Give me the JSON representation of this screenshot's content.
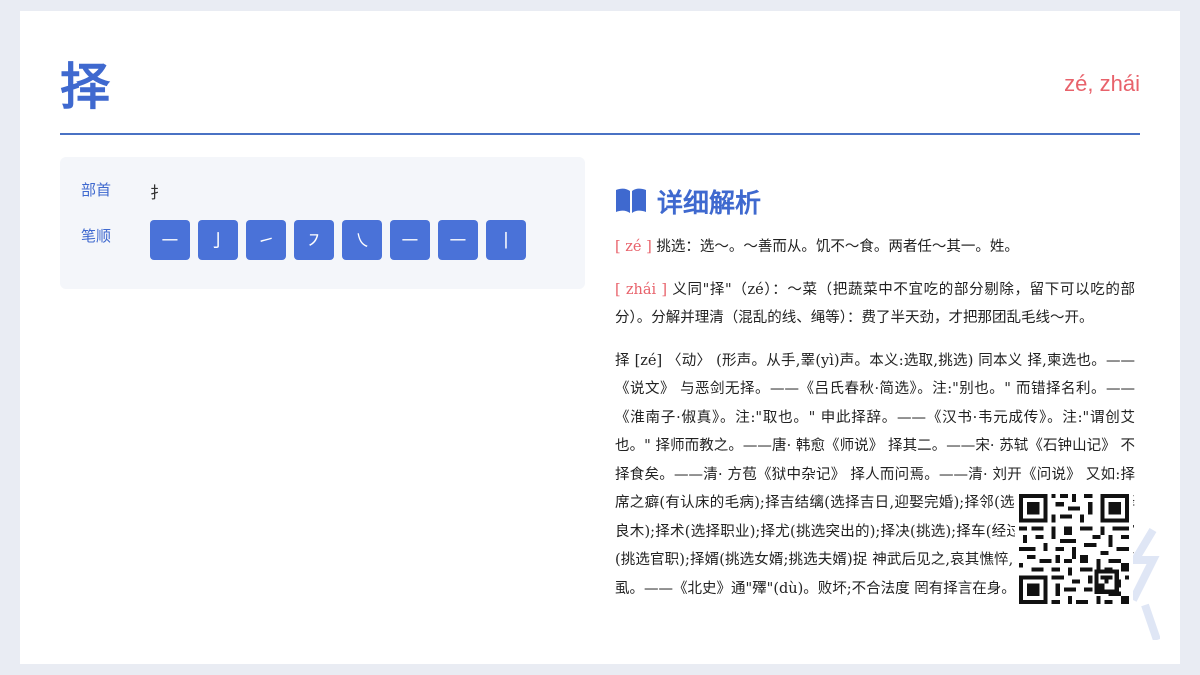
{
  "header": {
    "character": "择",
    "pinyin": "zé, zhái"
  },
  "info": {
    "radical_label": "部首",
    "radical": "扌",
    "strokes_label": "笔顺",
    "strokes": [
      "㇐",
      "亅",
      "㇀",
      "㇇",
      "㇏",
      "㇐",
      "㇐",
      "丨"
    ]
  },
  "detail": {
    "title": "详细解析",
    "entries": [
      {
        "pron": "[ zé ]",
        "text": " 挑选：选～。～善而从。饥不～食。两者任～其一。姓。"
      },
      {
        "pron": "[ zhái ]",
        "text": " 义同\"择\"（zé）：～菜（把蔬菜中不宜吃的部分剔除，留下可以吃的部分）。分解并理清（混乱的线、绳等）：费了半天劲，才把那团乱毛线～开。"
      },
      {
        "pron": "",
        "text": "择 [zé] 〈动〉 (形声。从手,睪(yì)声。本义:选取,挑选) 同本义 择,柬选也。——《说文》 与恶剑无择。——《吕氏春秋·简选》。注:\"别也。\" 而错择名利。——《淮南子·俶真》。注:\"取也。\" 申此择辞。——《汉书·韦元成传》。注:\"谓创艾也。\" 择师而教之。——唐· 韩愈《师说》 择其二。——宋· 苏轼《石钟山记》 不择食矣。——清· 方苞《狱中杂记》 择人而问焉。——清· 刘开《问说》 又如:择席之癖(有认床的毛病);择吉结缡(选择吉日,迎娶完婚);择邻(选择邻居);择木(选择良木);择术(选择职业);择尤(挑选突出的);择决(挑选);择车(经过选择的好车);择官(挑选官职);择婿(挑选女婿;挑选夫婿)捉 神武后见之,哀其憔悴,以膝承其首,亲为择虱。——《北史》通\"殬\"(dù)。败坏;不合法度 罔有择言在身。"
      }
    ]
  },
  "colors": {
    "accent": "#3f69cf",
    "pinyin": "#e8626b",
    "stroke_button": "#4a72d8"
  }
}
